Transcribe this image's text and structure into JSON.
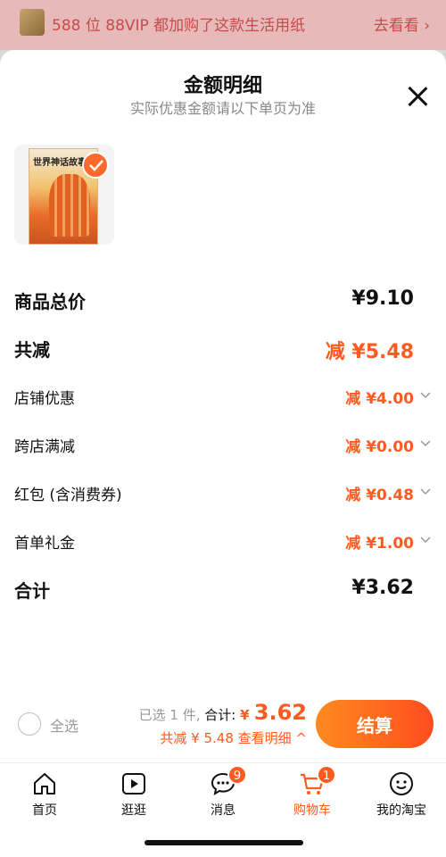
{
  "banner": {
    "text": "588 位 88VIP 都加购了这款生活用纸",
    "link": "去看看 ›"
  },
  "sheet": {
    "title": "金额明细",
    "subtitle": "实际优惠金额请以下单页为准"
  },
  "product": {
    "book_title": "世界神话故事"
  },
  "rows": {
    "total_price": {
      "label": "商品总价",
      "value": "¥9.10"
    },
    "total_discount": {
      "label": "共减",
      "value": "减 ¥5.48"
    },
    "shop_coupon": {
      "label": "店铺优惠",
      "value": "减 ¥4.00"
    },
    "cross_shop": {
      "label": "跨店满减",
      "value": "减 ¥0.00"
    },
    "red_packet": {
      "label": "红包 (含消费券)",
      "value": "减 ¥0.48"
    },
    "first_order": {
      "label": "首单礼金",
      "value": "减 ¥1.00"
    },
    "sum": {
      "label": "合计",
      "value": "¥3.62"
    }
  },
  "checkout": {
    "select_all": "全选",
    "selected": "已选 1 件,",
    "total_label": "合计:",
    "total_symbol": "¥ ",
    "total_value": "3.62",
    "discount_line": "共减 ¥ 5.48  查看明细 ^",
    "pay_label": "结算"
  },
  "tabs": [
    {
      "label": "首页",
      "icon": "home-icon"
    },
    {
      "label": "逛逛",
      "icon": "play-icon"
    },
    {
      "label": "消息",
      "icon": "message-icon",
      "badge": "9"
    },
    {
      "label": "购物车",
      "icon": "cart-icon",
      "badge": "1"
    },
    {
      "label": "我的淘宝",
      "icon": "profile-icon"
    }
  ],
  "colors": {
    "accent": "#ff5a1f",
    "banner_text": "#c94a4a"
  }
}
